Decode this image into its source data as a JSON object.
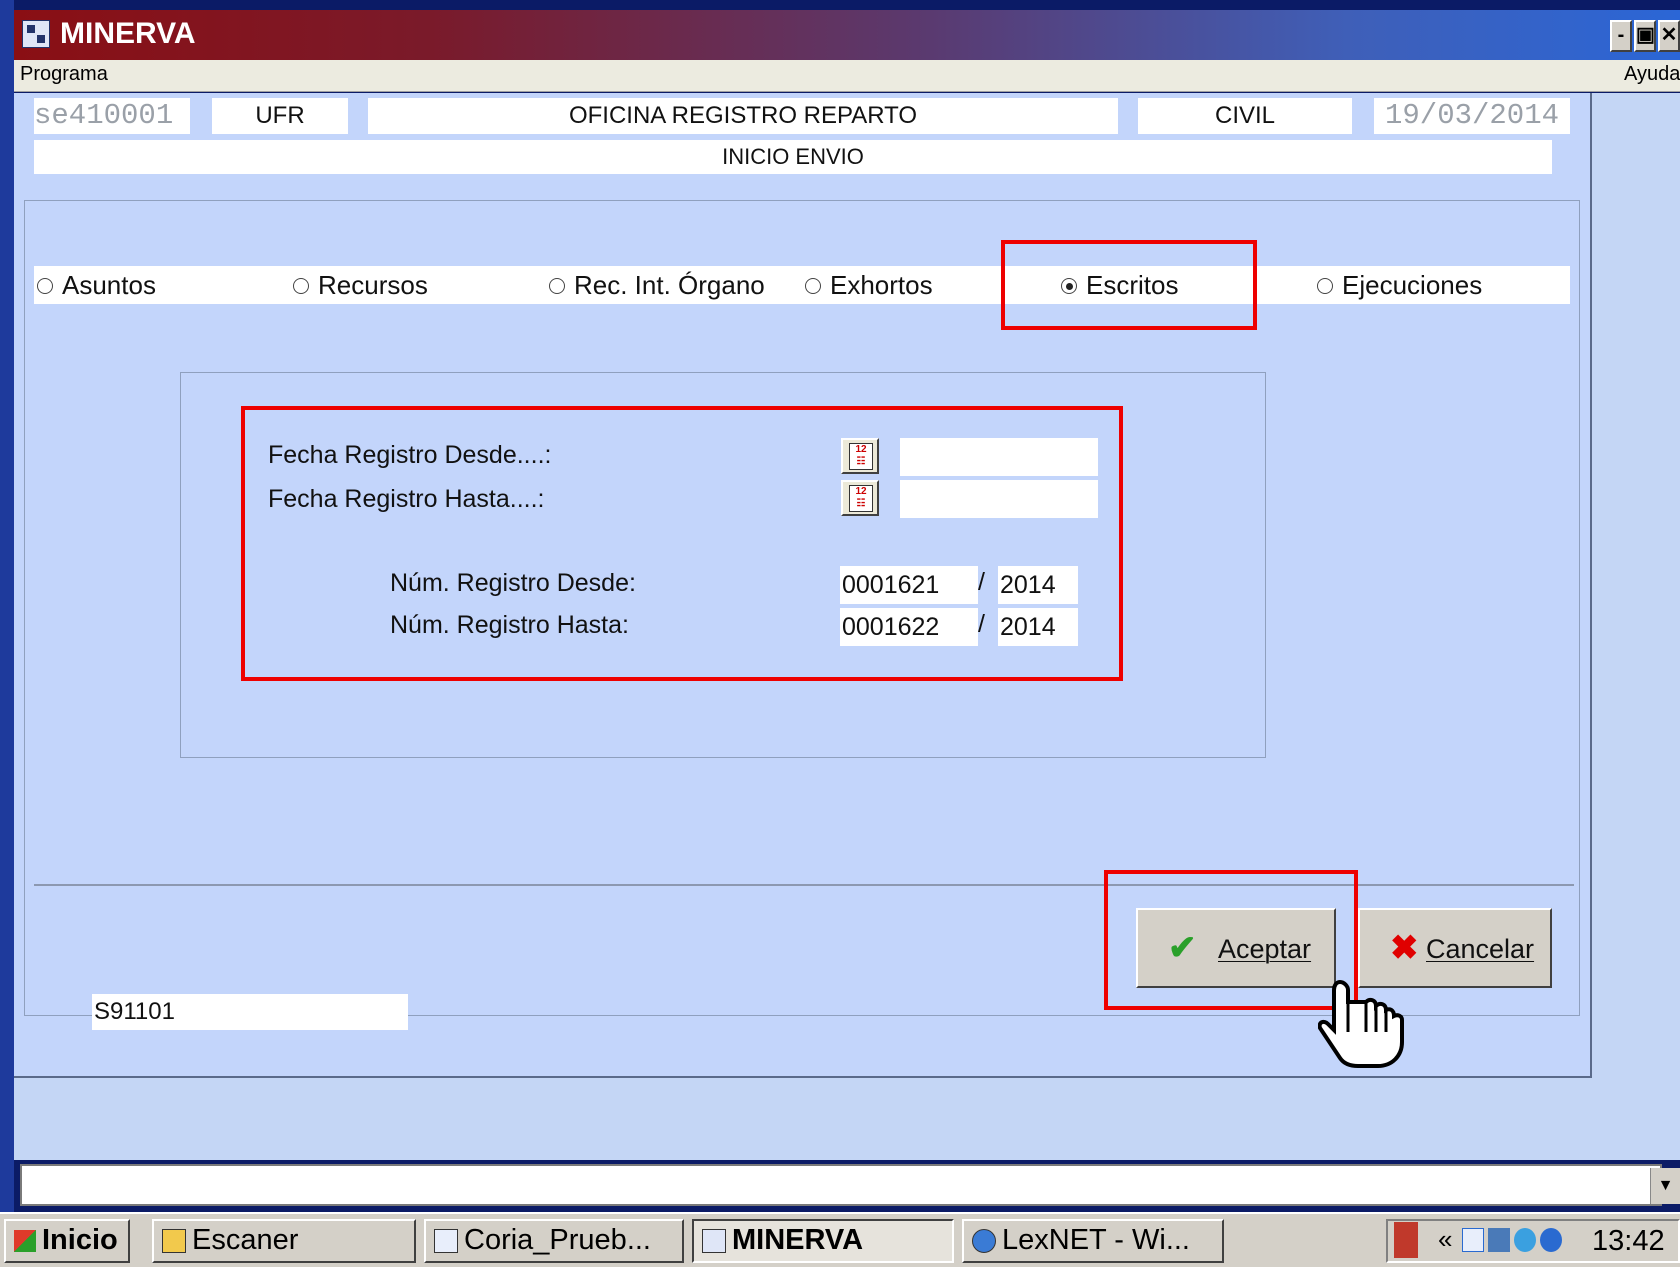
{
  "window": {
    "title": "MINERVA"
  },
  "menu": {
    "left": "Programa",
    "right": "Ayuda"
  },
  "header": {
    "code": "se410001",
    "unit": "UFR",
    "office": "OFICINA REGISTRO REPARTO",
    "jurisdiction": "CIVIL",
    "date": "19/03/2014",
    "subtitle": "INICIO ENVIO"
  },
  "types": {
    "selected": "Escritos",
    "options": [
      {
        "label": "Asuntos"
      },
      {
        "label": "Recursos"
      },
      {
        "label": "Rec. Int. Órgano"
      },
      {
        "label": "Exhortos"
      },
      {
        "label": "Escritos"
      },
      {
        "label": "Ejecuciones"
      }
    ]
  },
  "filters": {
    "fecha_desde_label": "Fecha Registro Desde....:",
    "fecha_hasta_label": "Fecha Registro Hasta....:",
    "fecha_desde_value": "",
    "fecha_hasta_value": "",
    "num_desde_label": "Núm. Registro Desde:",
    "num_hasta_label": "Núm. Registro Hasta:",
    "num_desde": "0001621",
    "num_desde_year": "2014",
    "num_hasta": "0001622",
    "num_hasta_year": "2014",
    "separator": "/"
  },
  "buttons": {
    "accept": "Aceptar",
    "cancel": "Cancelar"
  },
  "status": {
    "code": "S91101"
  },
  "taskbar": {
    "start": "Inicio",
    "items": [
      {
        "label": "Escaner"
      },
      {
        "label": "Coria_Prueb..."
      },
      {
        "label": "MINERVA"
      },
      {
        "label": "LexNET - Wi..."
      }
    ],
    "tray_arrow": "«",
    "clock": "13:42"
  },
  "colors": {
    "highlight": "#ee0000",
    "panel": "#c3d5fb",
    "titlebar_start": "#8a0f14",
    "titlebar_end": "#2b66d6"
  }
}
